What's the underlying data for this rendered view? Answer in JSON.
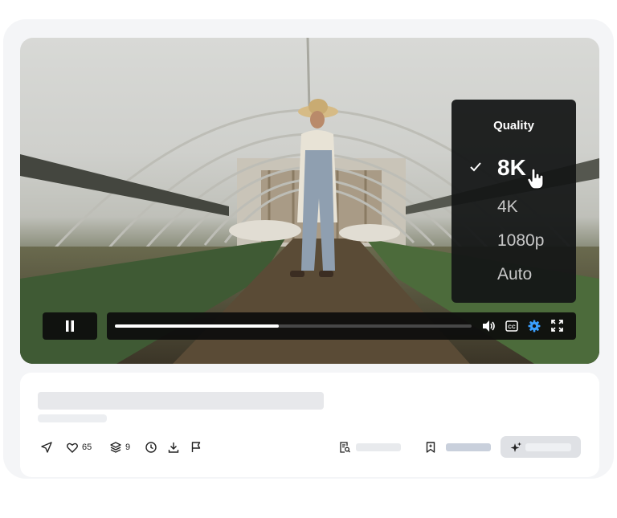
{
  "player": {
    "quality_menu": {
      "title": "Quality",
      "options": [
        {
          "label": "8K",
          "selected": true
        },
        {
          "label": "4K",
          "selected": false
        },
        {
          "label": "1080p",
          "selected": false
        },
        {
          "label": "Auto",
          "selected": false
        }
      ]
    },
    "progress": 0.46,
    "accent_color": "#3aa0ff",
    "controls": [
      "pause-icon",
      "volume-icon",
      "closed-captions-icon",
      "settings-gear-icon",
      "fullscreen-icon"
    ]
  },
  "actions": {
    "likes_count": "65",
    "layers_count": "9"
  }
}
